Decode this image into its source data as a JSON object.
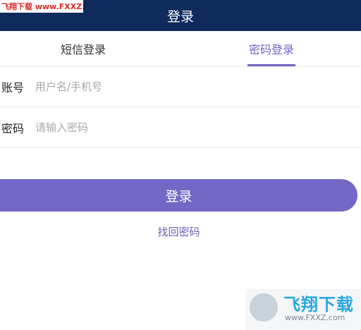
{
  "header": {
    "title": "登录"
  },
  "watermark_top": "飞翔下载 www.FXXZ.com",
  "tabs": [
    {
      "label": "短信登录",
      "active": false
    },
    {
      "label": "密码登录",
      "active": true
    }
  ],
  "form": {
    "account": {
      "label": "账号",
      "placeholder": "用户名/手机号",
      "value": ""
    },
    "password": {
      "label": "密码",
      "placeholder": "请输入密码",
      "value": ""
    }
  },
  "login_button": {
    "label": "登录"
  },
  "forgot_link": {
    "label": "找回密码"
  },
  "watermark_bottom": {
    "text": "飞翔下载",
    "sub": "www.FXXZ.com"
  },
  "colors": {
    "header_bg": "#0f2a5c",
    "accent": "#7468c6",
    "tab_active": "#7465c4"
  }
}
